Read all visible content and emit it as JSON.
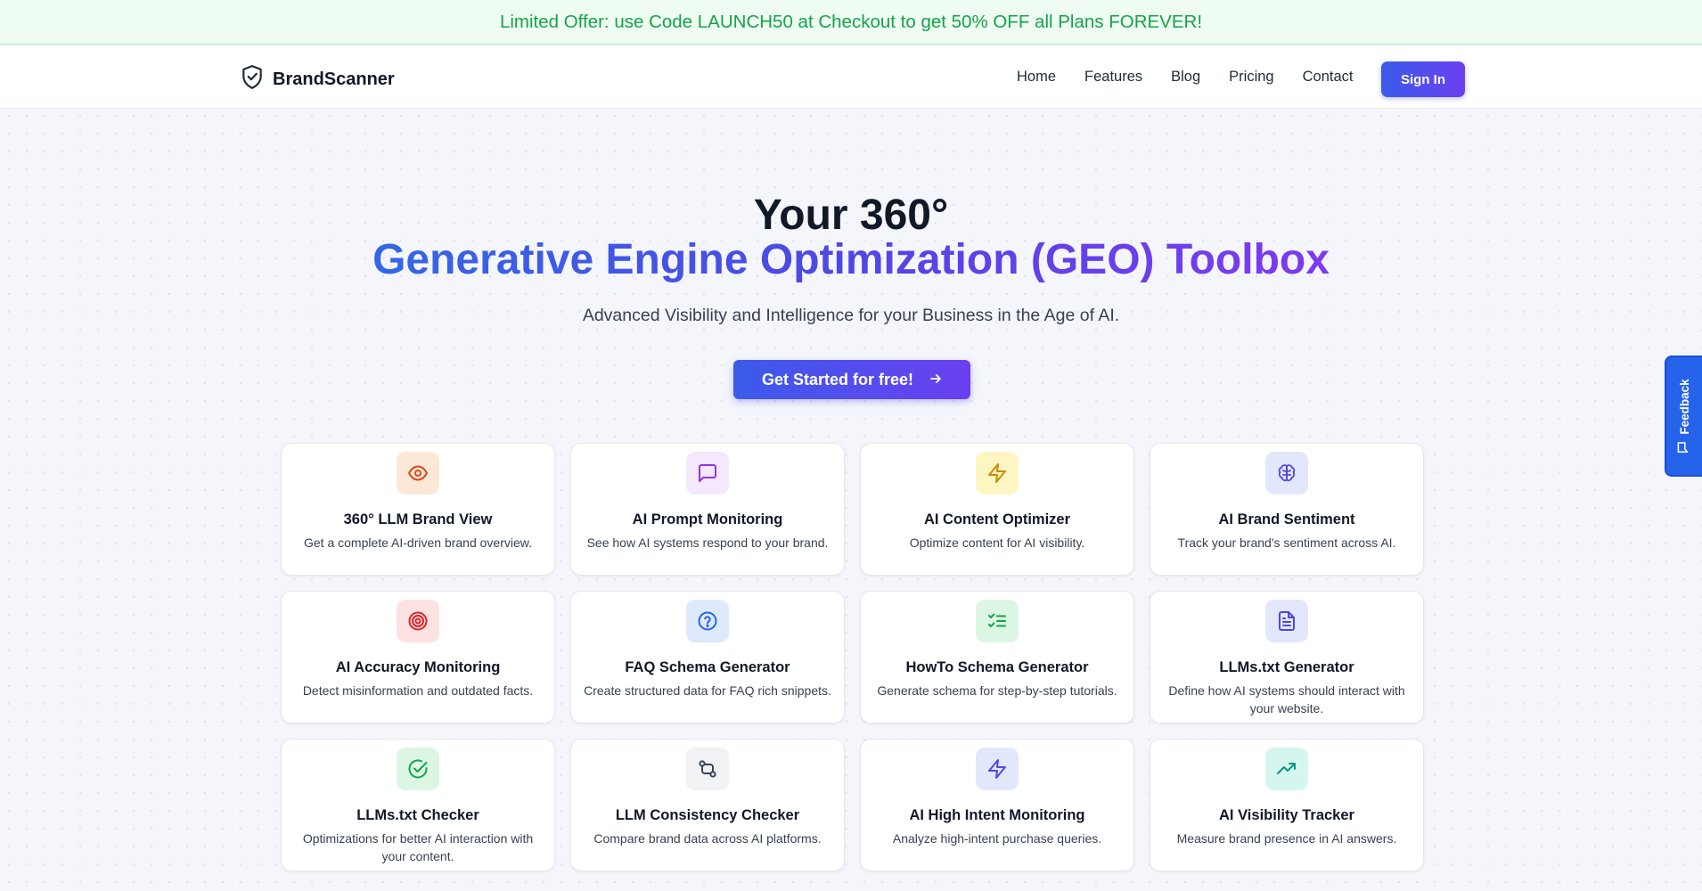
{
  "promo": {
    "text": "Limited Offer: use Code LAUNCH50 at Checkout to get 50% OFF all Plans FOREVER!"
  },
  "header": {
    "brand": "BrandScanner",
    "nav": [
      "Home",
      "Features",
      "Blog",
      "Pricing",
      "Contact"
    ],
    "signin_label": "Sign In"
  },
  "hero": {
    "line1": "Your 360°",
    "line2": "Generative Engine Optimization (GEO) Toolbox",
    "subtitle": "Advanced Visibility and Intelligence for your Business in the Age of AI.",
    "cta_label": "Get Started for free!"
  },
  "features": [
    {
      "title": "360° LLM Brand View",
      "desc": "Get a complete AI-driven brand overview.",
      "icon": "eye-icon",
      "color": "#dc4a1e"
    },
    {
      "title": "AI Prompt Monitoring",
      "desc": "See how AI systems respond to your brand.",
      "icon": "chat-icon",
      "color": "#9333ea"
    },
    {
      "title": "AI Content Optimizer",
      "desc": "Optimize content for AI visibility.",
      "icon": "bolt-icon",
      "color": "#ca8a04"
    },
    {
      "title": "AI Brand Sentiment",
      "desc": "Track your brand's sentiment across AI.",
      "icon": "brain-icon",
      "color": "#4f46e5"
    },
    {
      "title": "AI Accuracy Monitoring",
      "desc": "Detect misinformation and outdated facts.",
      "icon": "target-icon",
      "color": "#dc2626"
    },
    {
      "title": "FAQ Schema Generator",
      "desc": "Create structured data for FAQ rich snippets.",
      "icon": "question-icon",
      "color": "#2563eb"
    },
    {
      "title": "HowTo Schema Generator",
      "desc": "Generate schema for step-by-step tutorials.",
      "icon": "checklist-icon",
      "color": "#16a34a"
    },
    {
      "title": "LLMs.txt Generator",
      "desc": "Define how AI systems should interact with your website.",
      "icon": "document-icon",
      "color": "#4f46e5"
    },
    {
      "title": "LLMs.txt Checker",
      "desc": "Optimizations for better AI interaction with your content.",
      "icon": "check-circle-icon",
      "color": "#16a34a"
    },
    {
      "title": "LLM Consistency Checker",
      "desc": "Compare brand data across AI platforms.",
      "icon": "git-compare-icon",
      "color": "#374151"
    },
    {
      "title": "AI High Intent Monitoring",
      "desc": "Analyze high-intent purchase queries.",
      "icon": "bolt-icon",
      "color": "#4f46e5"
    },
    {
      "title": "AI Visibility Tracker",
      "desc": "Measure brand presence in AI answers.",
      "icon": "trending-up-icon",
      "color": "#0d9488"
    }
  ],
  "feedback": {
    "label": "Feedback"
  },
  "colors": {
    "accent_start": "#3b5bea",
    "accent_end": "#6b3ff0",
    "promo_green": "#16a34a",
    "feedback_blue": "#2563eb"
  }
}
